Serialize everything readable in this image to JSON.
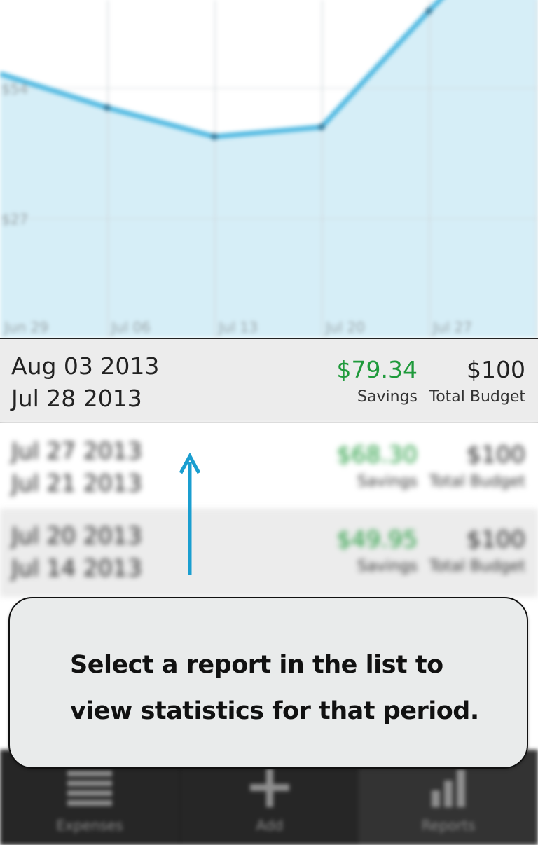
{
  "chart_data": {
    "type": "area",
    "x": [
      "Jun 29",
      "Jul 06",
      "Jul 13",
      "Jul 20",
      "Jul 27"
    ],
    "xlabels": [
      "Jun 29",
      "Jul 06",
      "Jul 13",
      "Jul 20",
      "Jul 27"
    ],
    "ytick_labels": [
      "$54",
      "$27"
    ],
    "yticks": [
      54,
      27
    ],
    "series": [
      {
        "values": [
          50,
          44,
          46,
          70
        ]
      }
    ],
    "grid": true,
    "colors": {
      "line": "#49b6e0",
      "fill": "#d6eef7",
      "grid": "#d0d6d9"
    }
  },
  "reports": [
    {
      "end_date": "Aug 03 2013",
      "start_date": "Jul 28 2013",
      "savings": "$79.34",
      "budget": "$100",
      "savings_label": "Savings",
      "budget_label": "Total Budget"
    },
    {
      "end_date": "Jul 27 2013",
      "start_date": "Jul 21 2013",
      "savings": "$68.30",
      "budget": "$100",
      "savings_label": "Savings",
      "budget_label": "Total Budget"
    },
    {
      "end_date": "Jul 20 2013",
      "start_date": "Jul 14 2013",
      "savings": "$49.95",
      "budget": "$100",
      "savings_label": "Savings",
      "budget_label": "Total Budget"
    }
  ],
  "tooltip": {
    "message": "Select a report in the list to view statistics for that period."
  },
  "actionbar": {
    "items": [
      {
        "label": "Expenses",
        "icon": "list-icon"
      },
      {
        "label": "Add",
        "icon": "plus-icon"
      },
      {
        "label": "Reports",
        "icon": "bar-chart-icon"
      }
    ]
  },
  "colors": {
    "savings": "#1f9a3b",
    "accent": "#1a9ed0",
    "actionbar": "#262626"
  }
}
